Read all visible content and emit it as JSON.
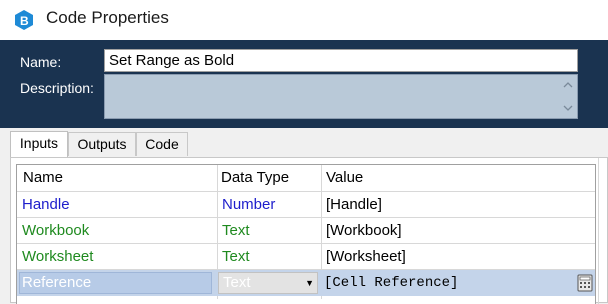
{
  "window": {
    "title": "Code Properties",
    "icon": "blue-b-app-icon"
  },
  "header": {
    "name_label": "Name:",
    "name_value": "Set Range as Bold",
    "description_label": "Description:",
    "description_value": ""
  },
  "tabs": [
    {
      "label": "Inputs",
      "active": true
    },
    {
      "label": "Outputs",
      "active": false
    },
    {
      "label": "Code",
      "active": false
    }
  ],
  "grid": {
    "columns": [
      "Name",
      "Data Type",
      "Value"
    ],
    "rows": [
      {
        "name": "Handle",
        "type": "Number",
        "value": "[Handle]"
      },
      {
        "name": "Workbook",
        "type": "Text",
        "value": "[Workbook]"
      },
      {
        "name": "Worksheet",
        "type": "Text",
        "value": "[Worksheet]"
      },
      {
        "name": "Reference",
        "type": "Text",
        "value": "[Cell Reference]",
        "selected": true
      }
    ]
  },
  "colors": {
    "header_bg": "#1a3350",
    "number_color": "#1e1ecc",
    "text_color": "#1f8a1f",
    "selection": "#c4d4ea"
  }
}
